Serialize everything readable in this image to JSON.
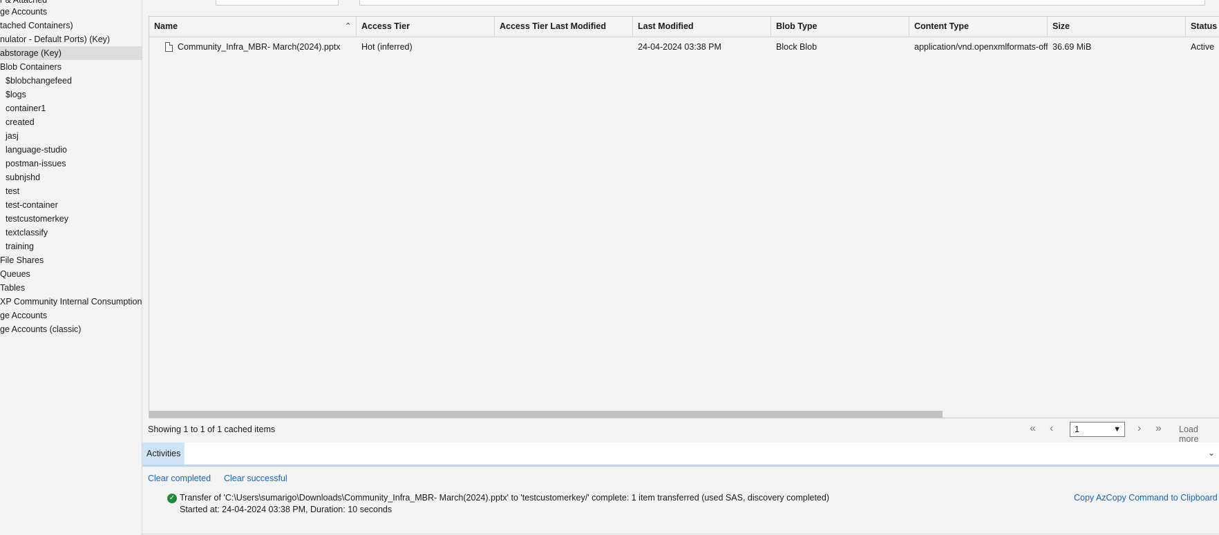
{
  "sidebar": {
    "items": [
      {
        "label": "r & Attached"
      },
      {
        "label": "ge Accounts"
      },
      {
        "label": "tached Containers)"
      },
      {
        "label": "nulator - Default Ports) (Key)"
      },
      {
        "label": "abstorage (Key)"
      },
      {
        "label": "Blob Containers"
      },
      {
        "label": "$blobchangefeed"
      },
      {
        "label": "$logs"
      },
      {
        "label": "container1"
      },
      {
        "label": "created"
      },
      {
        "label": "jasj"
      },
      {
        "label": "language-studio"
      },
      {
        "label": "postman-issues"
      },
      {
        "label": "subnjshd"
      },
      {
        "label": "test"
      },
      {
        "label": "test-container"
      },
      {
        "label": "testcustomerkey"
      },
      {
        "label": "textclassify"
      },
      {
        "label": "training"
      },
      {
        "label": "File Shares"
      },
      {
        "label": "Queues"
      },
      {
        "label": "Tables"
      },
      {
        "label": "XP Community Internal Consumption ("
      },
      {
        "label": "ge Accounts"
      },
      {
        "label": "ge Accounts (classic)"
      }
    ]
  },
  "grid": {
    "columns": [
      {
        "label": "Name"
      },
      {
        "label": "Access Tier"
      },
      {
        "label": "Access Tier Last Modified"
      },
      {
        "label": "Last Modified"
      },
      {
        "label": "Blob Type"
      },
      {
        "label": "Content Type"
      },
      {
        "label": "Size"
      },
      {
        "label": "Status"
      }
    ],
    "rows": [
      {
        "name": "Community_Infra_MBR- March(2024).pptx",
        "access_tier": "Hot (inferred)",
        "access_tier_last_modified": "",
        "last_modified": "24-04-2024 03:38 PM",
        "blob_type": "Block Blob",
        "content_type": "application/vnd.openxmlformats-offi",
        "size": "36.69 MiB",
        "status": "Active"
      }
    ]
  },
  "footer": {
    "showing": "Showing 1 to 1 of 1 cached items",
    "page_value": "1",
    "load_more": "Load more"
  },
  "activities": {
    "tab_label": "Activities",
    "clear_completed": "Clear completed",
    "clear_successful": "Clear successful",
    "transfer_text": "Transfer of 'C:\\Users\\sumarigo\\Downloads\\Community_Infra_MBR- March(2024).pptx' to 'testcustomerkey/' complete: 1 item transferred (used SAS, discovery completed)",
    "started_text": "Started at: 24-04-2024 03:38 PM, Duration: 10 seconds",
    "copy_command": "Copy AzCopy Command to Clipboard"
  }
}
